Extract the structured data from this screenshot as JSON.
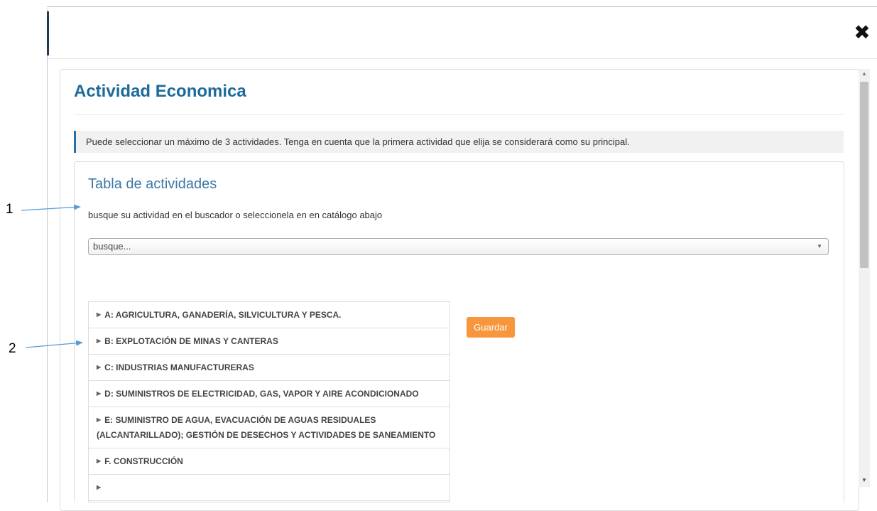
{
  "modal": {
    "close_icon": "close-icon"
  },
  "page": {
    "title": "Actividad Economica",
    "info": "Puede seleccionar un máximo de 3 actividades. Tenga en cuenta que la primera actividad que elija se considerará como su principal."
  },
  "activities": {
    "title": "Tabla de actividades",
    "hint": "busque su actividad en el buscador o seleccionela en en catálogo abajo",
    "search": {
      "placeholder": "busque..."
    },
    "save_label": "Guardar",
    "catalog": [
      "A: AGRICULTURA, GANADERÍA, SILVICULTURA Y PESCA.",
      "B: EXPLOTACIÓN DE MINAS Y CANTERAS",
      "C: INDUSTRIAS MANUFACTURERAS",
      "D: SUMINISTROS DE ELECTRICIDAD, GAS, VAPOR Y AIRE ACONDICIONADO",
      "E: SUMINISTRO DE AGUA, EVACUACIÓN DE AGUAS RESIDUALES (ALCANTARILLADO); GESTIÓN DE DESECHOS Y ACTIVIDADES DE SANEAMIENTO",
      "F. CONSTRUCCIÓN"
    ]
  },
  "annotations": [
    "1",
    "2"
  ],
  "colors": {
    "title": "#1d6a9a",
    "accent": "#2a6ea7",
    "button": "#f7963c",
    "arrow": "#5b9bd5"
  }
}
